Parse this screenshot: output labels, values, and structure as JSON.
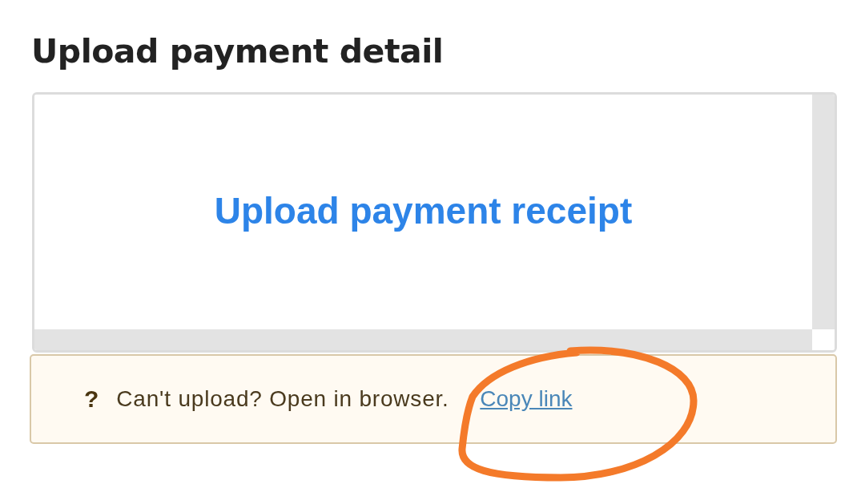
{
  "title": "Upload payment detail",
  "upload": {
    "label": "Upload payment receipt"
  },
  "notice": {
    "icon": "?",
    "text": "Can't upload? Open in browser.",
    "link": "Copy link"
  }
}
